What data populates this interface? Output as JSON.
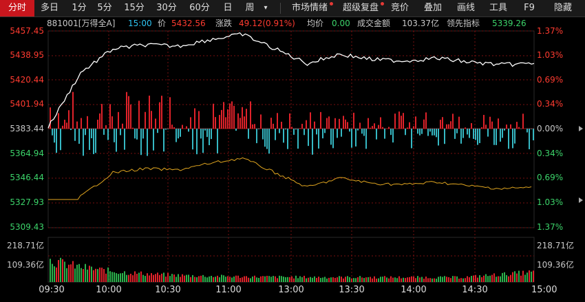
{
  "toolbar": {
    "tabs": [
      "分时",
      "多日",
      "1分",
      "5分",
      "15分",
      "30分",
      "60分",
      "日",
      "周",
      "▾"
    ],
    "tools": [
      "市场情绪",
      "超级复盘",
      "竞价",
      "叠加",
      "画线",
      "工具",
      "F9",
      "隐藏"
    ]
  },
  "info": {
    "code": "881001[万得全A]",
    "time": "15:00",
    "price_label": "价",
    "price": "5432.56",
    "change_label": "涨跌",
    "change": "49.12(0.91%)",
    "avg_label": "均价",
    "avg": "0.00",
    "turnover_label": "成交金额",
    "turnover": "103.37亿",
    "lead_label": "领先指标",
    "lead": "5339.26"
  },
  "axis": {
    "left": [
      "5457.45",
      "5438.95",
      "5420.44",
      "5401.94",
      "5383.44",
      "5364.94",
      "5346.44",
      "5327.93",
      "5309.43"
    ],
    "right": [
      "1.37%",
      "1.03%",
      "0.69%",
      "0.34%",
      "0.00%",
      "0.34%",
      "0.69%",
      "1.03%",
      "1.37%"
    ],
    "vol_left": [
      "218.71亿",
      "109.36亿"
    ],
    "vol_right": [
      "218.71亿",
      "109.36亿"
    ],
    "x": [
      "09:30",
      "10:00",
      "10:30",
      "11:00",
      "13:00",
      "13:30",
      "14:00",
      "14:30",
      "15:00"
    ]
  },
  "chart_data": {
    "type": "line",
    "x": [
      "09:30",
      "10:00",
      "10:30",
      "11:00",
      "11:30/13:00",
      "13:30",
      "14:00",
      "14:30",
      "15:00"
    ],
    "ylim": [
      5309.43,
      5457.45
    ],
    "series": [
      {
        "values": [
          5385,
          5426,
          5444,
          5447,
          5446,
          5451,
          5455,
          5444,
          5433,
          5440,
          5436,
          5435,
          5437,
          5434,
          5432,
          5433
        ]
      }
    ]
  },
  "colors": {
    "price_line": "#ffffff",
    "lead_line": "#e0a51f",
    "up": "#e0222a",
    "down": "#36b9c4",
    "grid": "#7a1010"
  }
}
